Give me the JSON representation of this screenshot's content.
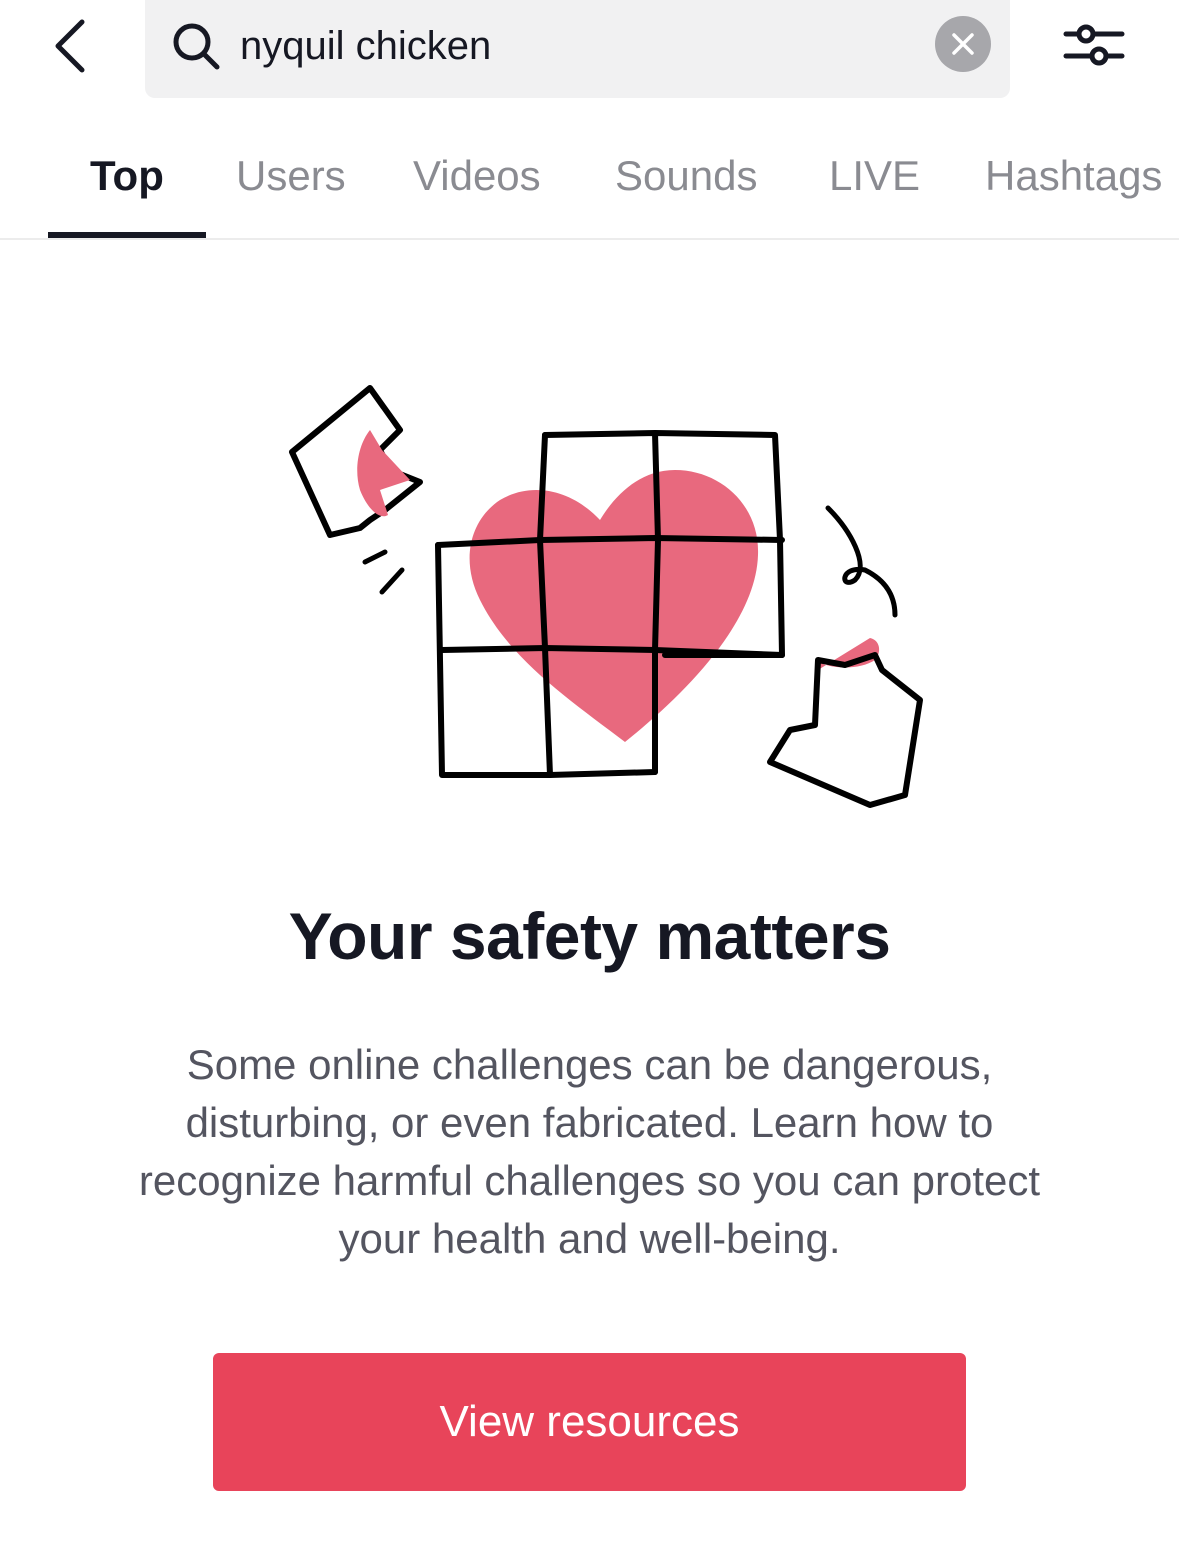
{
  "header": {
    "back_icon": "chevron-left-icon",
    "search": {
      "icon": "search-icon",
      "value": "nyquil chicken",
      "clear_icon": "close-icon"
    },
    "filter_icon": "sliders-icon"
  },
  "tabs": [
    {
      "label": "Top",
      "active": true
    },
    {
      "label": "Users",
      "active": false
    },
    {
      "label": "Videos",
      "active": false
    },
    {
      "label": "Sounds",
      "active": false
    },
    {
      "label": "LIVE",
      "active": false
    },
    {
      "label": "Hashtags",
      "active": false
    }
  ],
  "illustration": {
    "icon": "puzzle-heart-illustration",
    "accent_color": "#e8697e",
    "line_color": "#000000"
  },
  "content": {
    "title": "Your safety matters",
    "description": "Some online challenges can be dangerous, disturbing, or even fabricated. Learn how to recognize harmful challenges so you can protect your health and well-being.",
    "button_label": "View resources",
    "button_color": "#e8445a"
  }
}
